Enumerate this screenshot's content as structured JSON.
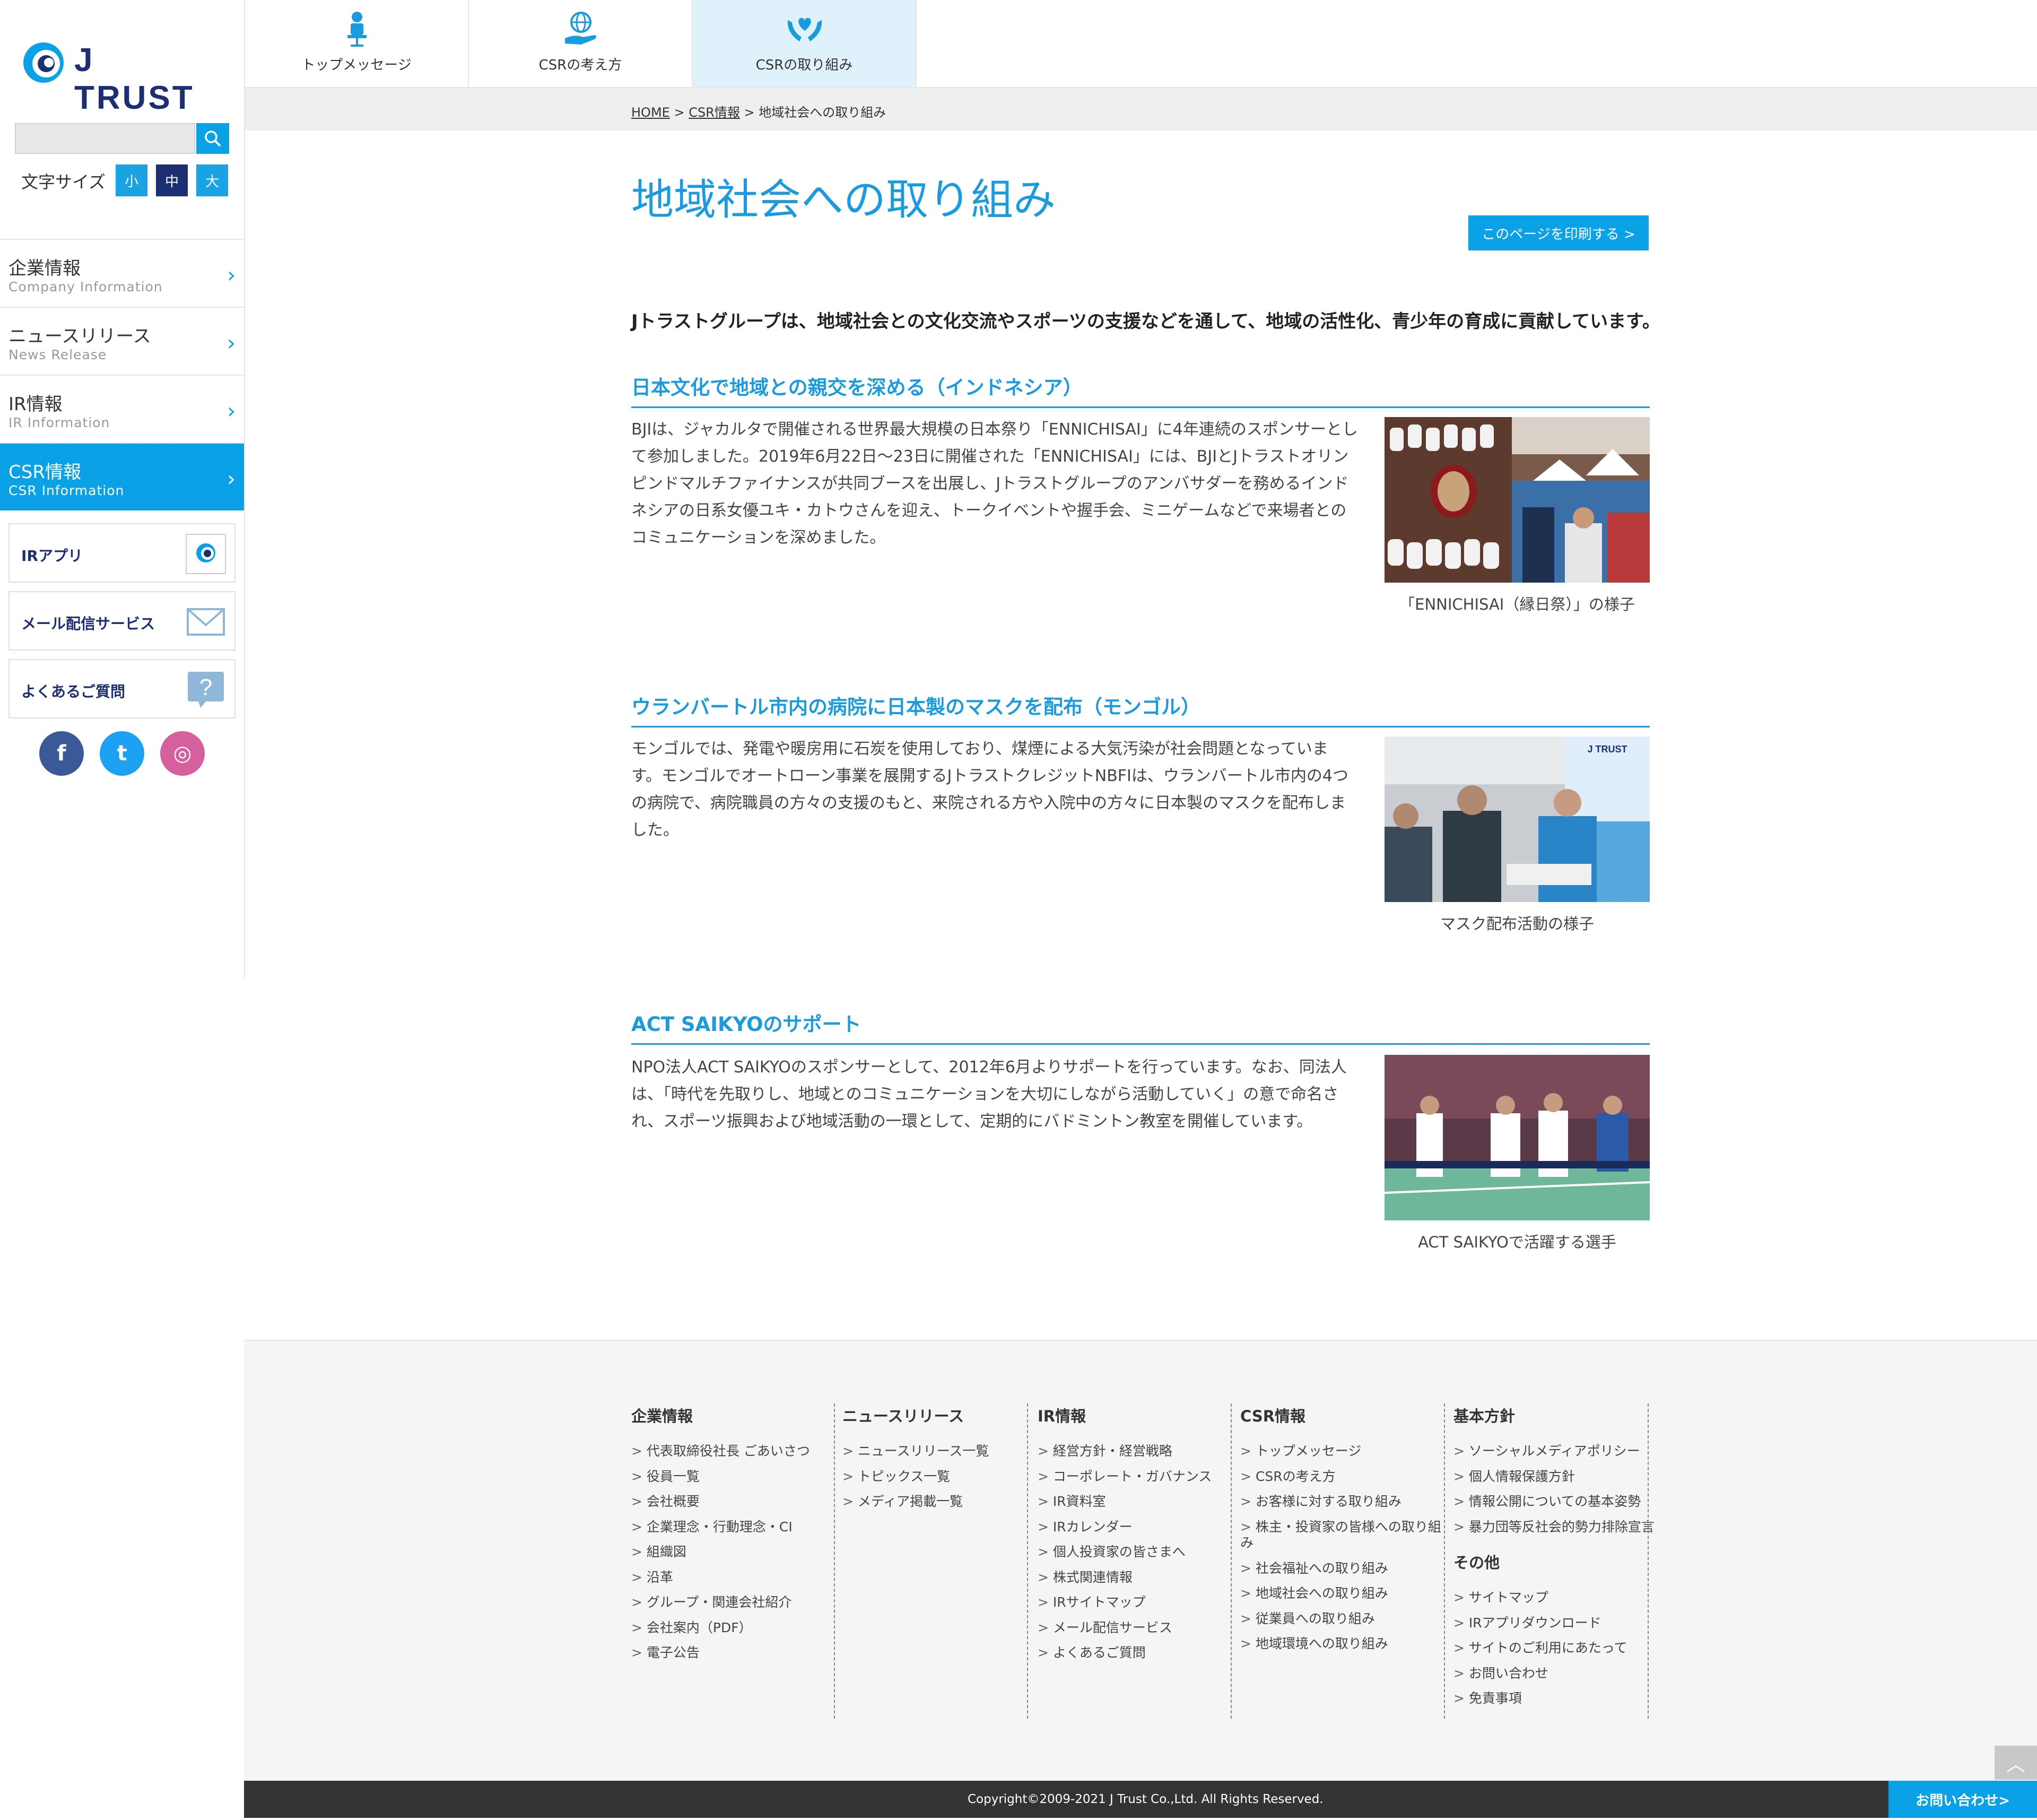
{
  "brand": {
    "logo_text": "J TRUST",
    "accent": "#0ba1e6",
    "navy": "#1c2f73"
  },
  "sidebar": {
    "search_placeholder": "",
    "font_size_label": "文字サイズ",
    "font_sizes": [
      "小",
      "中",
      "大"
    ],
    "nav": [
      {
        "jp": "企業情報",
        "en": "Company Information"
      },
      {
        "jp": "ニュースリリース",
        "en": "News Release"
      },
      {
        "jp": "IR情報",
        "en": "IR Information"
      },
      {
        "jp": "CSR情報",
        "en": "CSR Information"
      }
    ],
    "apps": [
      {
        "label": "IRアプリ",
        "icon": "jtrust-app-icon"
      },
      {
        "label": "メール配信サービス",
        "icon": "mail-icon"
      },
      {
        "label": "よくあるご質問",
        "icon": "question-icon"
      }
    ],
    "social": [
      {
        "glyph": "f",
        "icon": "facebook-icon",
        "color": "#3b5998"
      },
      {
        "glyph": "t",
        "icon": "twitter-icon",
        "color": "#1da1f2"
      },
      {
        "glyph": "◎",
        "icon": "instagram-icon",
        "color": "#d6609e"
      }
    ]
  },
  "tabs": [
    {
      "label": "トップメッセージ",
      "icon": "person-chair-icon"
    },
    {
      "label": "CSRの考え方",
      "icon": "globe-hand-icon"
    },
    {
      "label": "CSRの取り組み",
      "icon": "heart-hands-icon"
    }
  ],
  "breadcrumb": {
    "home": "HOME",
    "sep": ">",
    "csr": "CSR情報",
    "current": "地域社会への取り組み"
  },
  "main": {
    "title": "地域社会への取り組み",
    "print_label": "このページを印刷する >",
    "intro": "Jトラストグループは、地域社会との文化交流やスポーツの支援などを通して、地域の活性化、青少年の育成に貢献しています。",
    "sections": [
      {
        "heading": "日本文化で地域との親交を深める（インドネシア）",
        "body": "BJIは、ジャカルタで開催される世界最大規模の日本祭り「ENNICHISAI」に4年連続のスポンサーとして参加しました。2019年6月22日〜23日に開催された「ENNICHISAI」には、BJIとJトラストオリンピンドマルチファイナンスが共同ブースを出展し、Jトラストグループのアンバサダーを務めるインドネシアの日系女優ユキ・カトウさんを迎え、トークイベントや握手会、ミニゲームなどで来場者とのコミュニケーションを深めました。",
        "caption": "「ENNICHISAI（縁日祭）」の様子"
      },
      {
        "heading": "ウランバートル市内の病院に日本製のマスクを配布（モンゴル）",
        "body": "モンゴルでは、発電や暖房用に石炭を使用しており、煤煙による大気汚染が社会問題となっています。モンゴルでオートローン事業を展開するJトラストクレジットNBFIは、ウランバートル市内の4つの病院で、病院職員の方々の支援のもと、来院される方や入院中の方々に日本製のマスクを配布しました。",
        "caption": "マスク配布活動の様子"
      },
      {
        "heading": "ACT SAIKYOのサポート",
        "body": "NPO法人ACT SAIKYOのスポンサーとして、2012年6月よりサポートを行っています。なお、同法人は、「時代を先取りし、地域とのコミュニケーションを大切にしながら活動していく」の意で命名され、スポーツ振興および地域活動の一環として、定期的にバドミントン教室を開催しています。",
        "caption": "ACT SAIKYOで活躍する選手"
      }
    ]
  },
  "footer": {
    "columns": [
      {
        "head": "企業情報",
        "items": [
          "代表取締役社長 ごあいさつ",
          "役員一覧",
          "会社概要",
          "企業理念・行動理念・CI",
          "組織図",
          "沿革",
          "グループ・関連会社紹介",
          "会社案内（PDF）",
          "電子公告"
        ]
      },
      {
        "head": "ニュースリリース",
        "items": [
          "ニュースリリース一覧",
          "トピックス一覧",
          "メディア掲載一覧"
        ]
      },
      {
        "head": "IR情報",
        "items": [
          "経営方針・経営戦略",
          "コーポレート・ガバナンス",
          "IR資料室",
          "IRカレンダー",
          "個人投資家の皆さまへ",
          "株式関連情報",
          "IRサイトマップ",
          "メール配信サービス",
          "よくあるご質問"
        ]
      },
      {
        "head": "CSR情報",
        "items": [
          "トップメッセージ",
          "CSRの考え方",
          "お客様に対する取り組み",
          "株主・投資家の皆様への取り組み",
          "社会福祉への取り組み",
          "地域社会への取り組み",
          "従業員への取り組み",
          "地域環境への取り組み"
        ]
      },
      {
        "head": "基本方針",
        "items": [
          "ソーシャルメディアポリシー",
          "個人情報保護方針",
          "情報公開についての基本姿勢",
          "暴力団等反社会的勢力排除宣言"
        ],
        "head2": "その他",
        "items2": [
          "サイトマップ",
          "IRアプリダウンロード",
          "サイトのご利用にあたって",
          "お問い合わせ",
          "免責事項"
        ]
      }
    ],
    "copyright": "Copyright©2009-2021 J Trust Co.,Ltd. All Rights Reserved.",
    "contact_label": "お問い合わせ>",
    "totop_glyph": "︿"
  }
}
